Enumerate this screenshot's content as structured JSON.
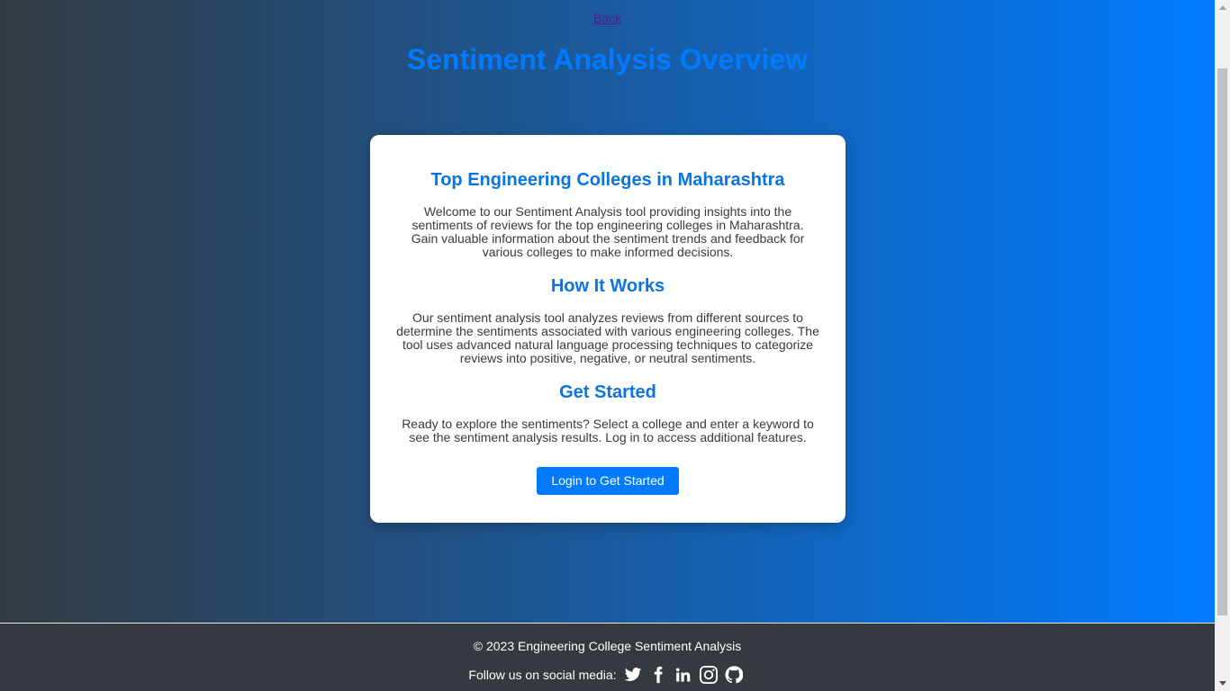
{
  "nav": {
    "back_label": "Back"
  },
  "header": {
    "title": "Sentiment Analysis Overview"
  },
  "card": {
    "section1": {
      "heading": "Top Engineering Colleges in Maharashtra",
      "text": "Welcome to our Sentiment Analysis tool providing insights into the sentiments of reviews for the top engineering colleges in Maharashtra. Gain valuable information about the sentiment trends and feedback for various colleges to make informed decisions."
    },
    "section2": {
      "heading": "How It Works",
      "text": "Our sentiment analysis tool analyzes reviews from different sources to determine the sentiments associated with various engineering colleges. The tool uses advanced natural language processing techniques to categorize reviews into positive, negative, or neutral sentiments."
    },
    "section3": {
      "heading": "Get Started",
      "text": "Ready to explore the sentiments? Select a college and enter a keyword to see the sentiment analysis results. Log in to access additional features."
    },
    "button_label": "Login to Get Started"
  },
  "footer": {
    "copyright": "© 2023 Engineering College Sentiment Analysis",
    "social_label": "Follow us on social media:",
    "social_icons": [
      "twitter-icon",
      "facebook-icon",
      "linkedin-icon",
      "instagram-icon",
      "github-icon"
    ]
  },
  "colors": {
    "gradient_start": "#343a40",
    "gradient_end": "#007bff",
    "accent": "#007bff",
    "footer_bg": "#343a40"
  }
}
